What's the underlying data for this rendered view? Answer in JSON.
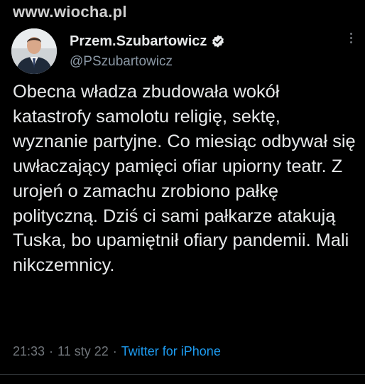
{
  "watermark": "www.wiocha.pl",
  "author": {
    "display_name": "Przem.Szubartowicz",
    "handle": "@PSzubartowicz",
    "verified": true
  },
  "tweet": {
    "text": "Obecna władza zbudowała wokół katastrofy samolotu religię, sektę, wyznanie partyjne. Co miesiąc odbywał się uwłaczający pamięci ofiar upiorny teatr. Z urojeń o zamachu zrobiono pałkę polityczną. Dziś ci sami pałkarze atakują Tuska, bo upamiętnił ofiary pandemii. Mali nikczemnicy.",
    "time": "21:33",
    "date": "11 sty 22",
    "separator": "·",
    "source": "Twitter for iPhone"
  },
  "colors": {
    "background": "#000000",
    "text": "#e7e9ea",
    "muted": "#71767b",
    "link": "#1d9bf0",
    "verified_badge": "#e7e9ea"
  },
  "icons": {
    "verified": "verified-badge-icon",
    "menu": "more-vertical-icon"
  }
}
